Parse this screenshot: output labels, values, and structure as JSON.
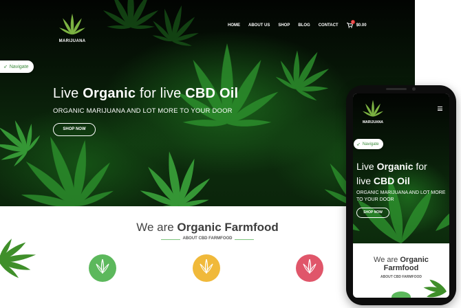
{
  "brand": {
    "name": "MARIJUANA",
    "accent": "#3a8a3a",
    "badge_color": "#e03030"
  },
  "nav": {
    "items": [
      "HOME",
      "ABOUT US",
      "SHOP",
      "BLOG",
      "CONTACT"
    ],
    "cart_icon": "cart-icon",
    "cart_count": "0",
    "cart_total": "$0.00"
  },
  "navigate": {
    "label": "Navigate",
    "icon": "paper-plane-icon"
  },
  "hero": {
    "headline_pre": "Live ",
    "headline_bold1": "Organic",
    "headline_mid": " for live ",
    "headline_bold2": "CBD Oil",
    "subheading": "ORGANIC MARIJUANA AND LOT MORE TO YOUR DOOR",
    "button": "SHOP NOW"
  },
  "about": {
    "title_pre": "We are ",
    "title_bold": "Organic Farmfood",
    "subtitle": "ABOUT CBD FARMFOOD",
    "features": [
      {
        "icon": "leaf-icon",
        "color": "#5cb85c"
      },
      {
        "icon": "leaf-icon",
        "color": "#f0b93a"
      },
      {
        "icon": "leaf-icon",
        "color": "#e0566a"
      }
    ]
  },
  "mobile": {
    "menu_icon": "hamburger-menu-icon",
    "headline_line1_pre": "Live ",
    "headline_line1_bold": "Organic",
    "headline_line1_post": " for",
    "headline_line2_pre": "live ",
    "headline_line2_bold": "CBD Oil",
    "subheading": "ORGANIC MARIJUANA AND LOT MORE TO YOUR DOOR",
    "button": "SHOP NOW",
    "about_pre": "We are ",
    "about_bold1": "Organic",
    "about_bold2": "Farmfood",
    "about_subtitle": "ABOUT CBD FARMFOOD"
  }
}
